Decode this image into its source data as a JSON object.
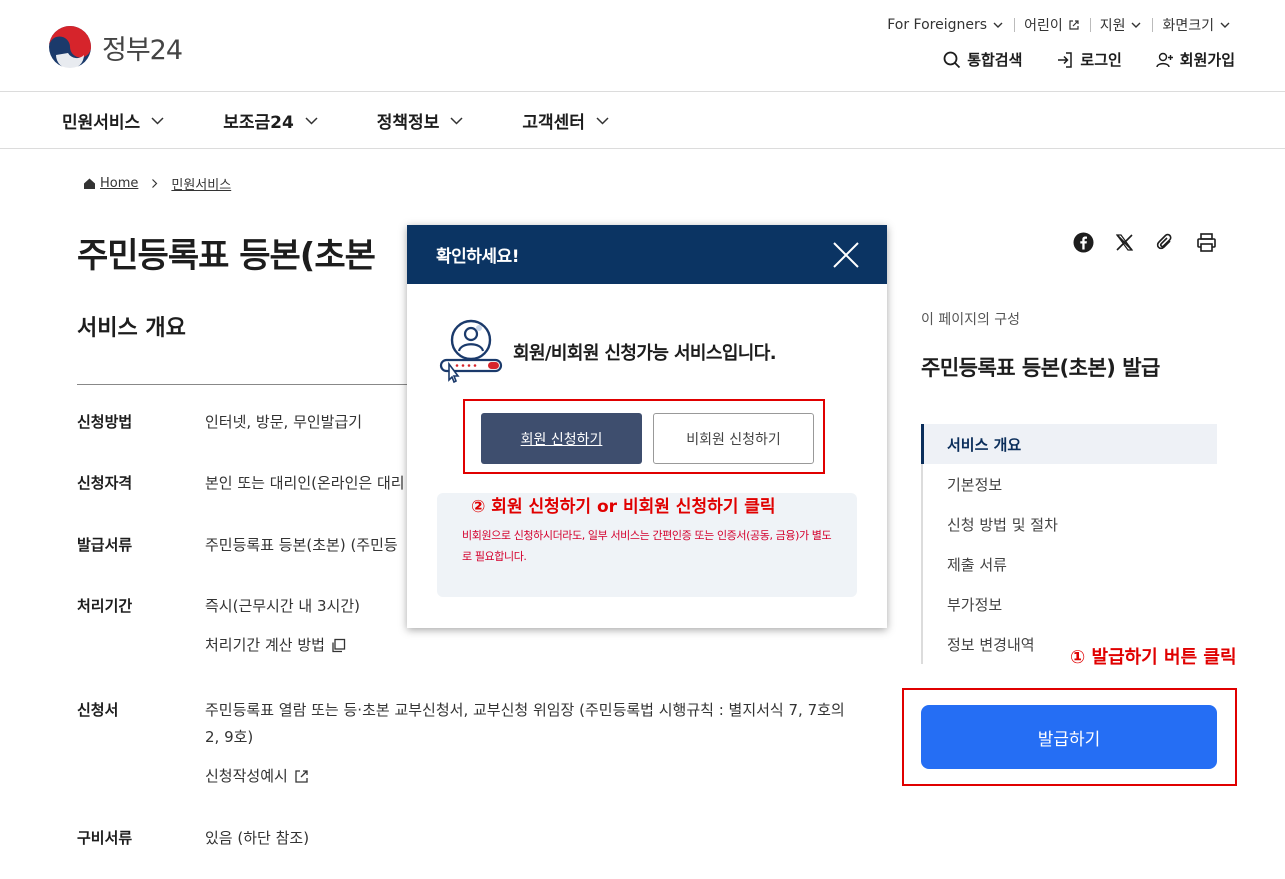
{
  "header": {
    "logo_text": "정부24",
    "util": [
      "For Foreigners",
      "어린이",
      "지원",
      "화면크기"
    ],
    "actions": [
      "통합검색",
      "로그인",
      "회원가입"
    ]
  },
  "gnb": [
    "민원서비스",
    "보조금24",
    "정책정보",
    "고객센터"
  ],
  "breadcrumb": {
    "home": "Home",
    "current": "민원서비스"
  },
  "page": {
    "title": "주민등록표 등본(초본",
    "section_title": "서비스 개요"
  },
  "info": [
    {
      "label": "신청방법",
      "value": "인터넷, 방문, 무인발급기"
    },
    {
      "label": "신청자격",
      "value": "본인 또는 대리인(온라인은 대리"
    },
    {
      "label": "발급서류",
      "value": "주민등록표 등본(초본) (주민등"
    },
    {
      "label": "처리기간",
      "value": "즉시(근무시간 내 3시간)",
      "link": "처리기간 계산 방법"
    },
    {
      "label": "신청서",
      "value": "주민등록표 열람 또는 등·초본 교부신청서, 교부신청 위임장 (주민등록법 시행규칙 : 별지서식 7, 7호의2, 9호)",
      "link": "신청작성예시"
    },
    {
      "label": "구비서류",
      "value": "있음 (하단 참조)"
    }
  ],
  "toc": {
    "caption": "이 페이지의 구성",
    "title": "주민등록표 등본(초본) 발급",
    "items": [
      "서비스 개요",
      "기본정보",
      "신청 방법 및 절차",
      "제출 서류",
      "부가정보",
      "정보 변경내역"
    ]
  },
  "issue_button": "발급하기",
  "annotations": {
    "step1": "① 발급하기 버튼 클릭",
    "step2": "② 회원 신청하기 or 비회원 신청하기 클릭"
  },
  "modal": {
    "title": "확인하세요!",
    "message": "회원/비회원 신청가능 서비스입니다.",
    "member_button": "회원 신청하기",
    "guest_button": "비회원 신청하기",
    "notice": "비회원으로 신청하시더라도, 일부 서비스는 간편인증 또는 인증서(공동, 금융)가 별도로 필요합니다."
  },
  "colors": {
    "modal_header": "#0b3463",
    "primary_button": "#256ef4",
    "annotation_red": "#e00000"
  }
}
